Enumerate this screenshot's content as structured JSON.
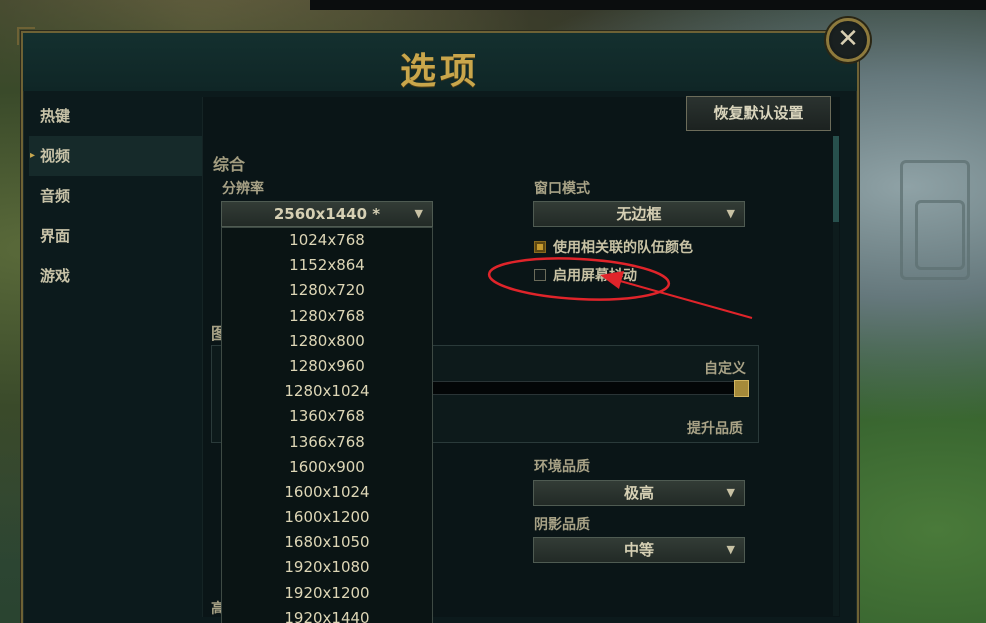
{
  "window": {
    "title": "选项",
    "close_glyph": "✕"
  },
  "sidebar": {
    "items": [
      {
        "label": "热键",
        "active": false
      },
      {
        "label": "视频",
        "active": true
      },
      {
        "label": "音频",
        "active": false
      },
      {
        "label": "界面",
        "active": false
      },
      {
        "label": "游戏",
        "active": false
      }
    ]
  },
  "toolbar": {
    "reset_label": "恢复默认设置"
  },
  "general": {
    "section_title": "综合",
    "resolution_label": "分辨率",
    "resolution_value": "2560x1440 *",
    "window_mode_label": "窗口模式",
    "window_mode_value": "无边框",
    "team_color_label": "使用相关联的队伍颜色",
    "team_color_checked": true,
    "screen_shake_label": "启用屏幕抖动",
    "screen_shake_checked": false
  },
  "graphics": {
    "partial_heading": "图",
    "preset_label": "自定义",
    "improve_label": "提升品质",
    "environment_label": "环境品质",
    "environment_value": "极高",
    "shadow_label": "阴影品质",
    "shadow_value": "中等",
    "bottom_partial": "高"
  },
  "resolution_options": [
    "1024x768",
    "1152x864",
    "1280x720",
    "1280x768",
    "1280x800",
    "1280x960",
    "1280x1024",
    "1360x768",
    "1366x768",
    "1600x900",
    "1600x1024",
    "1600x1200",
    "1680x1050",
    "1920x1080",
    "1920x1200",
    "1920x1440"
  ],
  "colors": {
    "accent_gold": "#c9a64b",
    "annotation_red": "#e0242a"
  },
  "icons": {
    "caret": "caret-down-icon",
    "arrow": "red-arrow-annotation"
  }
}
